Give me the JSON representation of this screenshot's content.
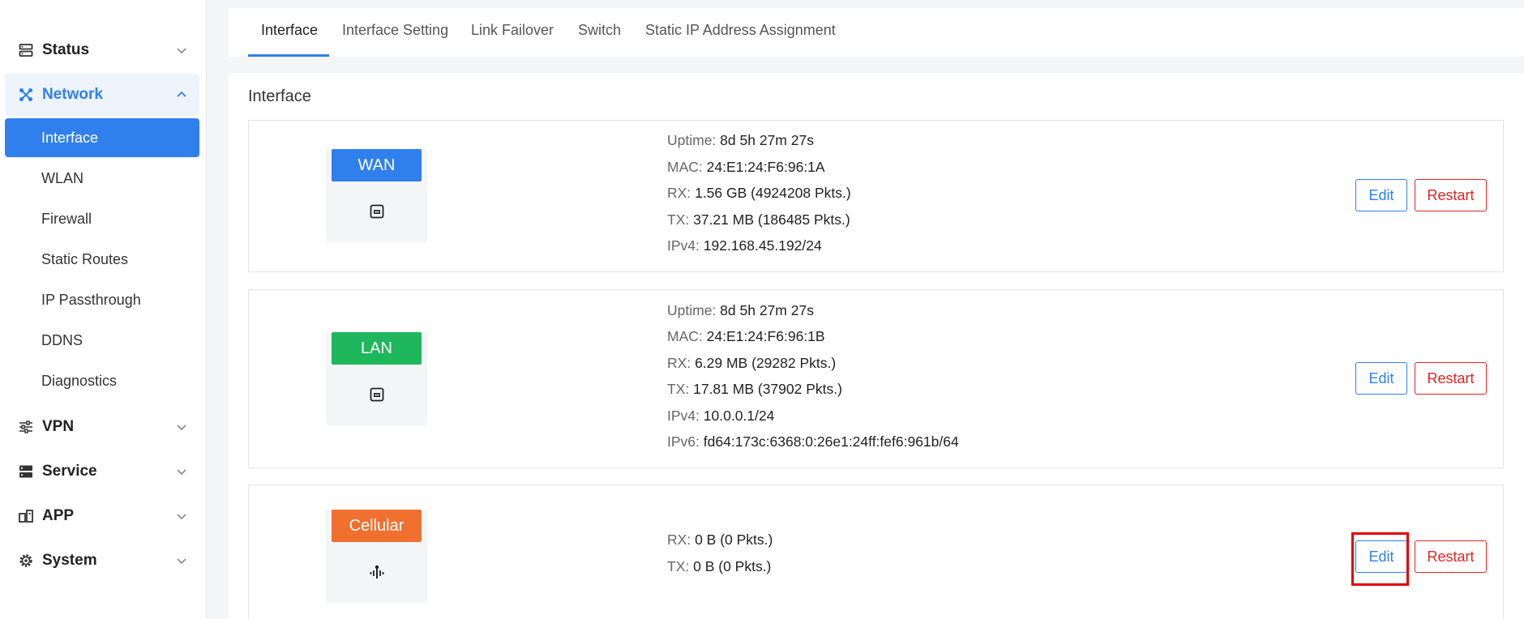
{
  "sidebar": {
    "groups": {
      "status": {
        "label": "Status",
        "icon": "status-icon"
      },
      "network": {
        "label": "Network",
        "icon": "network-icon"
      },
      "vpn": {
        "label": "VPN",
        "icon": "vpn-icon"
      },
      "service": {
        "label": "Service",
        "icon": "service-icon"
      },
      "app": {
        "label": "APP",
        "icon": "app-icon"
      },
      "system": {
        "label": "System",
        "icon": "gear-icon"
      }
    },
    "network_items": [
      "Interface",
      "WLAN",
      "Firewall",
      "Static Routes",
      "IP Passthrough",
      "DDNS",
      "Diagnostics"
    ]
  },
  "tabs": [
    "Interface",
    "Interface Setting",
    "Link Failover",
    "Switch",
    "Static IP Address Assignment"
  ],
  "section_title": "Interface",
  "colors": {
    "accent": "#2f80ed",
    "wan": "#2f80ed",
    "lan": "#1eb75c",
    "cellular": "#f07030",
    "danger": "#e02424",
    "highlight": "#e00000"
  },
  "interfaces": {
    "wan": {
      "name": "WAN",
      "icon": "ethernet-port-icon",
      "info": [
        {
          "key": "Uptime:",
          "value": "8d 5h 27m 27s"
        },
        {
          "key": "MAC:",
          "value": "24:E1:24:F6:96:1A"
        },
        {
          "key": "RX:",
          "value": "1.56 GB (4924208 Pkts.)"
        },
        {
          "key": "TX:",
          "value": "37.21 MB (186485 Pkts.)"
        },
        {
          "key": "IPv4:",
          "value": "192.168.45.192/24"
        }
      ]
    },
    "lan": {
      "name": "LAN",
      "icon": "ethernet-port-icon",
      "info": [
        {
          "key": "Uptime:",
          "value": "8d 5h 27m 27s"
        },
        {
          "key": "MAC:",
          "value": "24:E1:24:F6:96:1B"
        },
        {
          "key": "RX:",
          "value": "6.29 MB (29282 Pkts.)"
        },
        {
          "key": "TX:",
          "value": "17.81 MB (37902 Pkts.)"
        },
        {
          "key": "IPv4:",
          "value": "10.0.0.1/24"
        },
        {
          "key": "IPv6:",
          "value": "fd64:173c:6368:0:26e1:24ff:fef6:961b/64"
        }
      ]
    },
    "cellular": {
      "name": "Cellular",
      "icon": "signal-tower-icon",
      "info": [
        {
          "key": "RX:",
          "value": "0 B (0 Pkts.)"
        },
        {
          "key": "TX:",
          "value": "0 B (0 Pkts.)"
        }
      ]
    }
  },
  "buttons": {
    "edit": "Edit",
    "restart": "Restart"
  }
}
